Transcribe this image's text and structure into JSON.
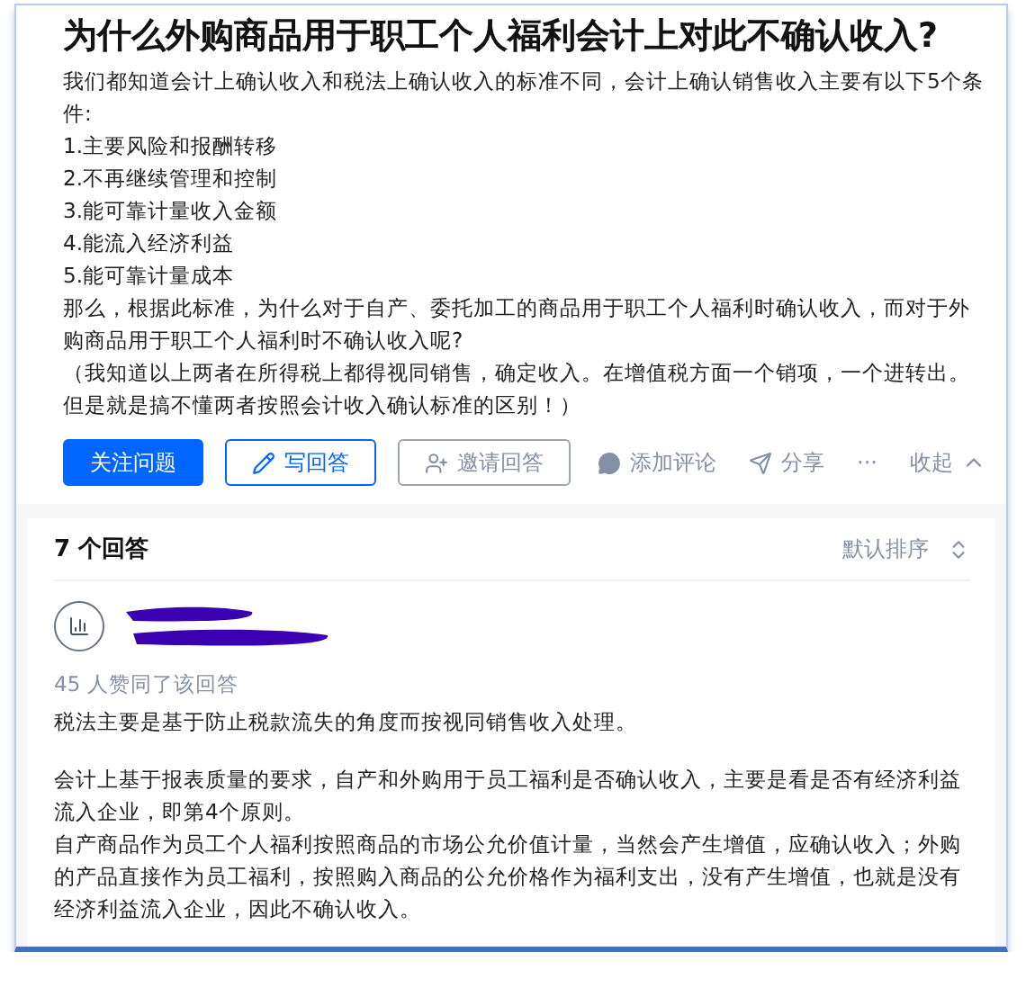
{
  "question": {
    "title": "为什么外购商品用于职工个人福利会计上对此不确认收入?",
    "paragraphs": [
      "我们都知道会计上确认收入和税法上确认收入的标准不同，会计上确认销售收入主要有以下5个条件:",
      "1.主要风险和报酬转移",
      "2.不再继续管理和控制",
      "3.能可靠计量收入金额",
      "4.能流入经济利益",
      "5.能可靠计量成本",
      "那么，根据此标准，为什么对于自产、委托加工的商品用于职工个人福利时确认收入，而对于外购商品用于职工个人福利时不确认收入呢?",
      "（我知道以上两者在所得税上都得视同销售，确定收入。在增值税方面一个销项，一个进转出。但是就是搞不懂两者按照会计收入确认标准的区别！）"
    ],
    "actions": [
      {
        "kind": "primary",
        "label": "关注问题"
      },
      {
        "kind": "outline",
        "label": "写回答"
      },
      {
        "kind": "grey",
        "label": "邀请回答"
      },
      {
        "kind": "plain",
        "label": "添加评论"
      },
      {
        "kind": "plain",
        "label": "分享"
      },
      {
        "kind": "plain",
        "label": "···"
      },
      {
        "kind": "plain",
        "label": "收起"
      }
    ]
  },
  "answers": {
    "count": "7 个回答",
    "sort": "默认排序",
    "answer": {
      "votes": "45 人赞同了该回答",
      "blocks": [
        [
          "税法主要是基于防止税款流失的角度而按视同销售收入处理。"
        ],
        [
          "会计上基于报表质量的要求，自产和外购用于员工福利是否确认收入，主要是看是否有经济利益流入企业，即第4个原则。",
          "自产商品作为员工个人福利按照商品的市场公允价值计量，当然会产生增值，应确认收入；外购的产品直接作为员工福利，按照购入商品的公允价格作为福利支出，没有产生增值，也就是没有经济利益流入企业，因此不确认收入。"
        ]
      ]
    }
  }
}
